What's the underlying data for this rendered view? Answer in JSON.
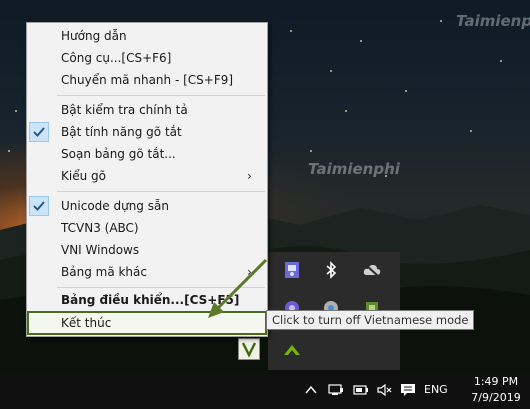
{
  "watermark": {
    "top_text": "Taimienphi",
    "middle_text": "Taimienphi"
  },
  "menu": {
    "items": [
      {
        "label": "Hướng dẫn",
        "checked": false,
        "submenu": false,
        "bold": false
      },
      {
        "label": "Công cụ...[CS+F6]",
        "checked": false,
        "submenu": false,
        "bold": false
      },
      {
        "label": "Chuyển mã nhanh - [CS+F9]",
        "checked": false,
        "submenu": false,
        "bold": false
      },
      {
        "label": "Bật kiểm tra chính tả",
        "checked": false,
        "submenu": false,
        "bold": false
      },
      {
        "label": "Bật tính năng gõ tắt",
        "checked": true,
        "submenu": false,
        "bold": false
      },
      {
        "label": "Soạn bảng gõ tắt...",
        "checked": false,
        "submenu": false,
        "bold": false
      },
      {
        "label": "Kiểu gõ",
        "checked": false,
        "submenu": true,
        "bold": false
      },
      {
        "label": "Unicode dựng sẵn",
        "checked": true,
        "submenu": false,
        "bold": false
      },
      {
        "label": "TCVN3 (ABC)",
        "checked": false,
        "submenu": false,
        "bold": false
      },
      {
        "label": "VNI Windows",
        "checked": false,
        "submenu": false,
        "bold": false
      },
      {
        "label": "Bảng mã khác",
        "checked": false,
        "submenu": true,
        "bold": false
      },
      {
        "label": "Bảng điều khiển...[CS+F5]",
        "checked": false,
        "submenu": false,
        "bold": true
      },
      {
        "label": "Kết thúc",
        "checked": false,
        "submenu": false,
        "bold": false,
        "highlighted": true
      }
    ]
  },
  "tooltip": {
    "text": "Click to turn off Vietnamese mode"
  },
  "tray_overflow": {
    "icons": [
      "media-icon",
      "bluetooth-icon",
      "cloud-off-icon",
      "shield-icon",
      "usb-icon",
      "sync-icon",
      "unikey-v-icon",
      "nvidia-icon"
    ]
  },
  "taskbar": {
    "language": "ENG",
    "time": "1:49 PM",
    "date": "7/9/2019",
    "icons": [
      "chevron-up-icon",
      "network-icon",
      "battery-icon",
      "speaker-muted-icon",
      "notification-icon"
    ]
  },
  "colors": {
    "menu_bg": "#f2f2f2",
    "check_bg": "#cce4f7",
    "highlight_border": "#4e6a20",
    "taskbar_bg": "#101010",
    "annotation_arrow": "#5a7a2a"
  }
}
